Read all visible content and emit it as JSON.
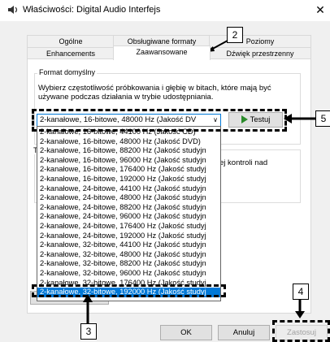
{
  "window": {
    "title": "Właściwości: Digital Audio Interfejs",
    "close_label": "✕"
  },
  "tabs": {
    "row1": [
      "Ogólne",
      "Obsługiwane formaty",
      "Poziomy"
    ],
    "row2": [
      "Enhancements",
      "Zaawansowane",
      "Dźwięk przestrzenny"
    ]
  },
  "default_format": {
    "group_label": "Format domyślny",
    "description": "Wybierz częstotliwość próbkowania i głębię w bitach, które mają być używane podczas działania w trybie udostępniania.",
    "selected_value": "2-kanałowe, 16-bitowe, 48000 Hz (Jakość DV",
    "test_label": "Testuj",
    "options": [
      "2-kanałowe, 16-bitowe, 44100 Hz (Jakość CD)",
      "2-kanałowe, 16-bitowe, 48000 Hz (Jakość DVD)",
      "2-kanałowe, 16-bitowe, 88200 Hz (Jakość studyjn",
      "2-kanałowe, 16-bitowe, 96000 Hz (Jakość studyjn",
      "2-kanałowe, 16-bitowe, 176400 Hz (Jakość studyj",
      "2-kanałowe, 16-bitowe, 192000 Hz (Jakość studyj",
      "2-kanałowe, 24-bitowe, 44100 Hz (Jakość studyjn",
      "2-kanałowe, 24-bitowe, 48000 Hz (Jakość studyjn",
      "2-kanałowe, 24-bitowe, 88200 Hz (Jakość studyjn",
      "2-kanałowe, 24-bitowe, 96000 Hz (Jakość studyjn",
      "2-kanałowe, 24-bitowe, 176400 Hz (Jakość studyj",
      "2-kanałowe, 24-bitowe, 192000 Hz (Jakość studyj",
      "2-kanałowe, 32-bitowe, 44100 Hz (Jakość studyjn",
      "2-kanałowe, 32-bitowe, 48000 Hz (Jakość studyjn",
      "2-kanałowe, 32-bitowe, 88200 Hz (Jakość studyjn",
      "2-kanałowe, 32-bitowe, 96000 Hz (Jakość studyjn",
      "2-kanałowe, 32-bitowe, 176400 Hz (Jakość studyj",
      "2-kanałowe, 32-bitowe, 192000 Hz (Jakość studyj"
    ],
    "selected_index": 17
  },
  "exclusive": {
    "group_label": "T",
    "text": "ej kontroli nad",
    "text2": "i"
  },
  "restore_label": "Przywróć domyślne",
  "buttons": {
    "ok": "OK",
    "cancel": "Anuluj",
    "apply": "Zastosuj"
  },
  "callouts": {
    "c2": "2",
    "c3": "3",
    "c4": "4",
    "c5": "5"
  }
}
